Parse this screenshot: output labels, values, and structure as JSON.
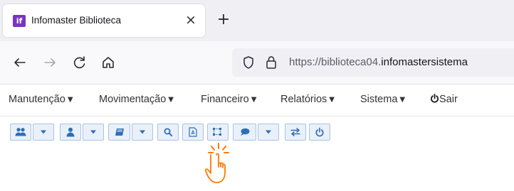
{
  "tab": {
    "favicon_text": "if",
    "title": "Infomaster Biblioteca",
    "close_glyph": "×"
  },
  "new_tab_glyph": "+",
  "nav": {
    "url_prefix": "https://biblioteca04.",
    "url_domain": "infomastersistema"
  },
  "menu": {
    "items": [
      {
        "label": "Manutenção",
        "caret": "▼"
      },
      {
        "label": "Movimentação",
        "caret": "▼"
      },
      {
        "label": "Financeiro",
        "caret": "▼"
      },
      {
        "label": "Relatórios",
        "caret": "▼"
      },
      {
        "label": "Sistema",
        "caret": "▼"
      }
    ],
    "logout_label": "Sair"
  },
  "toolbar": {
    "buttons": [
      "users-icon",
      "chevron-down-icon",
      "user-icon",
      "chevron-down-icon",
      "book-icon",
      "chevron-down-icon",
      "search-icon",
      "pdf-icon",
      "selection-icon",
      "comment-icon",
      "chevron-down-icon",
      "exchange-icon",
      "power-icon"
    ]
  },
  "colors": {
    "icon_blue": "#2d6fb6",
    "button_bg": "#e9f0f9",
    "button_border": "#a9c3e2",
    "favicon": "#7a34c2",
    "cursor_accent": "#ff7a00"
  }
}
